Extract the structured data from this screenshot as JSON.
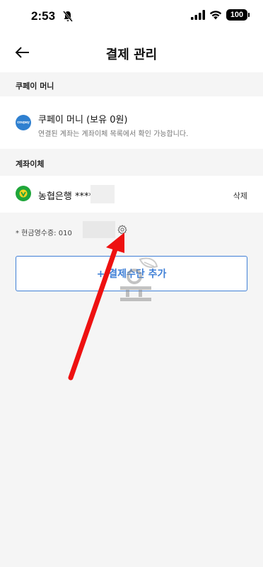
{
  "status_bar": {
    "time": "2:53",
    "battery": "100"
  },
  "header": {
    "title": "결제 관리"
  },
  "sections": {
    "coupay_money": "쿠페이 머니",
    "account_transfer": "계좌이체"
  },
  "coupay": {
    "logo_text": "coupay",
    "title": "쿠페이 머니 (보유 0원)",
    "description": "연결된 계좌는 계좌이체 목록에서 확인 가능합니다."
  },
  "bank": {
    "name": "농협은행 ****",
    "delete_label": "삭제"
  },
  "receipt": {
    "text": "* 현금영수증: 010"
  },
  "add_button": {
    "label": "+ 결제수단 추가"
  },
  "colors": {
    "accent": "#3f7fd6",
    "annotation_arrow": "#ee1111",
    "bank_logo": "#1fa63a",
    "coupay_logo": "#2f80d0"
  }
}
